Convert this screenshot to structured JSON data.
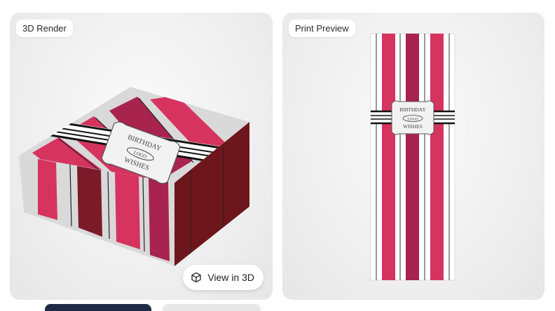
{
  "render_card": {
    "label": "3D Render",
    "view_button": "View in 3D"
  },
  "print_card": {
    "label": "Print Preview"
  },
  "label_art": {
    "line1": "BIRTHDAY",
    "logo": "LOGO",
    "line2": "WISHES"
  },
  "icons": {
    "view3d": "cube-icon"
  },
  "colors": {
    "stripe_main": "#d6335f",
    "stripe_dark": "#a8234e",
    "box_side_dark": "#7d1a1f",
    "box_grey": "#d8d8d8"
  }
}
